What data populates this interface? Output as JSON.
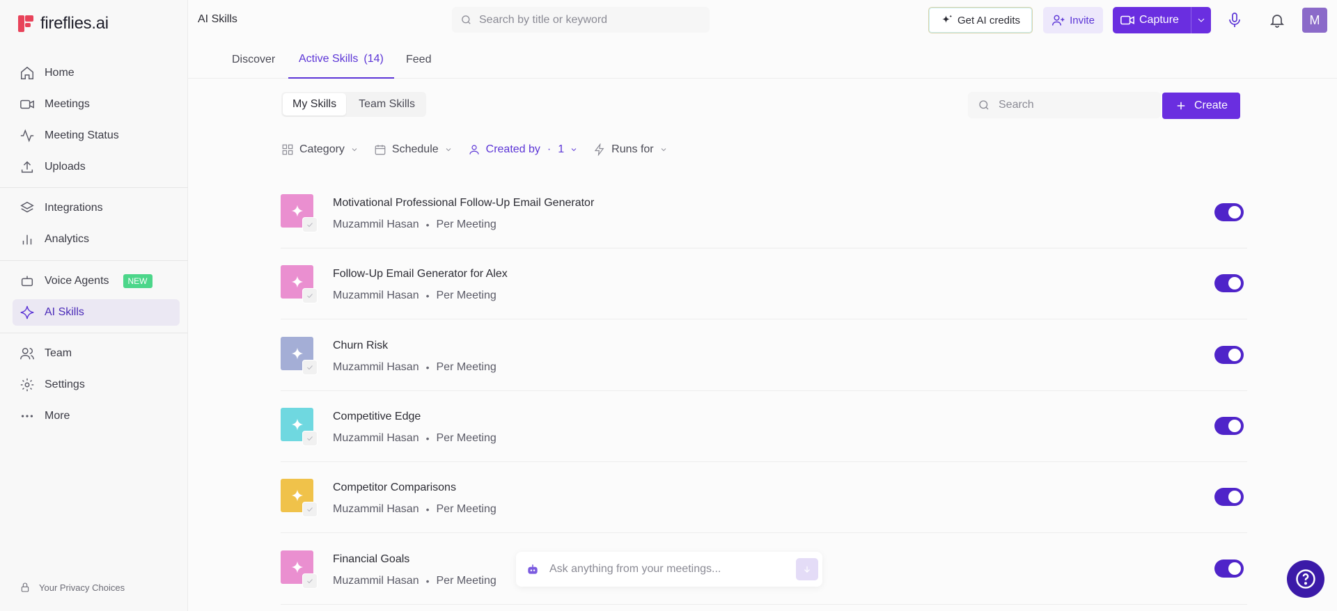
{
  "brand": {
    "name": "fireflies.ai"
  },
  "sidebar": {
    "items": [
      {
        "label": "Home",
        "icon": "home-icon"
      },
      {
        "label": "Meetings",
        "icon": "video-icon"
      },
      {
        "label": "Meeting Status",
        "icon": "activity-icon"
      },
      {
        "label": "Uploads",
        "icon": "upload-icon"
      },
      {
        "label": "Integrations",
        "icon": "layers-icon"
      },
      {
        "label": "Analytics",
        "icon": "bar-chart-icon"
      },
      {
        "label": "Voice Agents",
        "icon": "bot-icon",
        "badge": "NEW"
      },
      {
        "label": "AI Skills",
        "icon": "sparkle-icon",
        "active": true
      },
      {
        "label": "Team",
        "icon": "users-icon"
      },
      {
        "label": "Settings",
        "icon": "gear-icon"
      },
      {
        "label": "More",
        "icon": "more-icon"
      }
    ],
    "privacy": "Your Privacy Choices"
  },
  "topbar": {
    "page_label": "AI Skills",
    "search_placeholder": "Search by title or keyword",
    "credits_label": "Get AI credits",
    "invite_label": "Invite",
    "capture_label": "Capture",
    "avatar_initial": "M"
  },
  "tabs": [
    {
      "label": "Discover"
    },
    {
      "label": "Active Skills",
      "count": "(14)",
      "active": true
    },
    {
      "label": "Feed"
    }
  ],
  "segmented": {
    "my": "My Skills",
    "team": "Team Skills"
  },
  "list_search_placeholder": "Search",
  "create_label": "Create",
  "filters": {
    "category": "Category",
    "schedule": "Schedule",
    "created_by": "Created by",
    "created_by_count": "1",
    "runs_for": "Runs for"
  },
  "skills": [
    {
      "title": "Motivational Professional Follow-Up Email Generator",
      "author": "Muzammil Hasan",
      "frequency": "Per Meeting",
      "color": "#ea8fd0",
      "enabled": true
    },
    {
      "title": "Follow-Up Email Generator for Alex",
      "author": "Muzammil Hasan",
      "frequency": "Per Meeting",
      "color": "#ea8fd0",
      "enabled": true
    },
    {
      "title": "Churn Risk",
      "author": "Muzammil Hasan",
      "frequency": "Per Meeting",
      "color": "#a4aed6",
      "enabled": true
    },
    {
      "title": "Competitive Edge",
      "author": "Muzammil Hasan",
      "frequency": "Per Meeting",
      "color": "#6fd8e0",
      "enabled": true
    },
    {
      "title": "Competitor Comparisons",
      "author": "Muzammil Hasan",
      "frequency": "Per Meeting",
      "color": "#f0c24a",
      "enabled": true
    },
    {
      "title": "Financial Goals",
      "author": "Muzammil Hasan",
      "frequency": "Per Meeting",
      "color": "#ea8fd0",
      "enabled": true
    }
  ],
  "ask": {
    "placeholder": "Ask anything from your meetings..."
  }
}
